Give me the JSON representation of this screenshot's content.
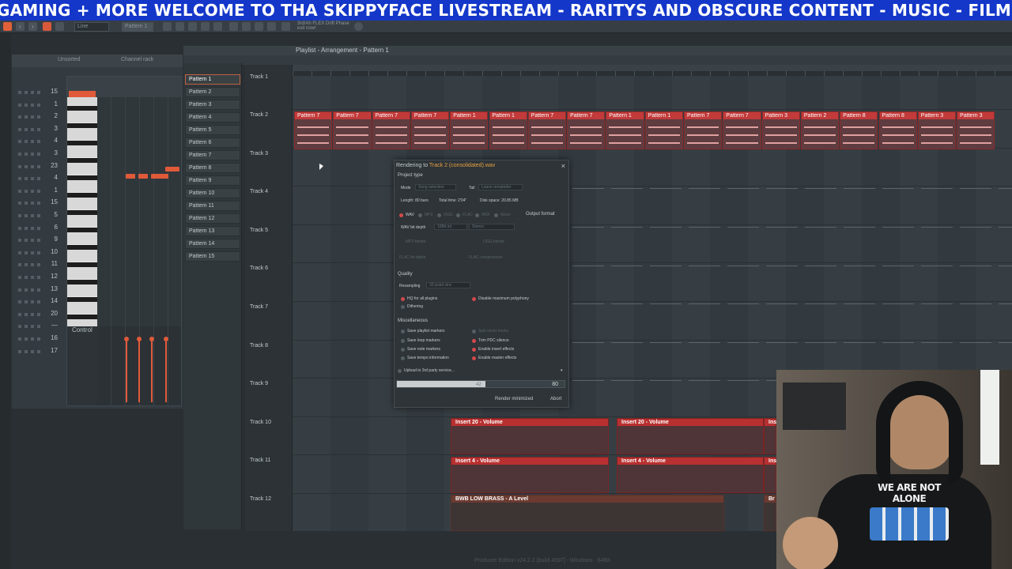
{
  "banner": {
    "text": "GAMING + MORE  WELCOME TO THA SKIPPYFACE LIVESTREAM  - RARITYS AND OBSCURE CONTENT - MUSIC - FILM - RANDOM"
  },
  "toolbar": {
    "mode_field": "Line",
    "pattern_field": "Pattern 1",
    "hint_line1": "3rd/Ah  FLEX Drift Phase",
    "hint_line2": "exit now!"
  },
  "channel_rack": {
    "title_left": "Unsorted",
    "title_right": "Channel rack",
    "numbers": [
      "15",
      "1",
      "2",
      "3",
      "4",
      "3",
      "23",
      "4",
      "1",
      "15",
      "5",
      "6",
      "9",
      "10",
      "11",
      "12",
      "13",
      "14",
      "20",
      "—",
      "16",
      "17"
    ]
  },
  "piano_roll": {
    "control_label": "Control"
  },
  "playlist": {
    "title": "Playlist - Arrangement - Pattern 1"
  },
  "patterns": [
    "Pattern 1",
    "Pattern 2",
    "Pattern 3",
    "Pattern 4",
    "Pattern 5",
    "Pattern 6",
    "Pattern 7",
    "Pattern 8",
    "Pattern 9",
    "Pattern 10",
    "Pattern 11",
    "Pattern 12",
    "Pattern 13",
    "Pattern 14",
    "Pattern 15"
  ],
  "tracks": [
    "Track 1",
    "Track 2",
    "Track 3",
    "Track 4",
    "Track 5",
    "Track 6",
    "Track 7",
    "Track 8",
    "Track 9",
    "Track 10",
    "Track 11",
    "Track 12"
  ],
  "track2_clips": [
    "Pattern 7",
    "Pattern 7",
    "Pattern 7",
    "Pattern 7",
    "Pattern 1",
    "Pattern 1",
    "Pattern 7",
    "Pattern 7",
    "Pattern 1",
    "Pattern 1",
    "Pattern 7",
    "Pattern 7",
    "Pattern 3",
    "Pattern 2",
    "Pattern 8",
    "Pattern 8",
    "Pattern 3",
    "Pattern 3"
  ],
  "automation_clips": {
    "insert20": "Insert 20 - Volume",
    "insert4": "Insert 4 - Volume",
    "brass": "BWB LOW BRASS - A Level",
    "ins": "Ins",
    "br": "Br"
  },
  "render_dialog": {
    "title_prefix": "Rendering to ",
    "title_file": "Track 2 (consolidated).wav",
    "close": "×",
    "project_type": "Project type",
    "mode_label": "Mode",
    "mode_value": "Song selection",
    "tail_label": "Tail",
    "tail_value": "Leave remainder",
    "length": "Length: 80 bars",
    "total_time": "Total time: 2'04\"",
    "disk_space": "Disk space: 20.85 MB",
    "output_format": "Output format",
    "formats": [
      "WAV",
      "MP3",
      "OGG",
      "FLAC",
      "MIDI",
      "Wave"
    ],
    "wav_bit_depth": "WAV bit depth",
    "wav_bit_value": "16Bit int",
    "stereo": "Stereo",
    "mp3_bitrate": "MP3 bitrate",
    "ogg_bitrate": "OGG bitrate",
    "flac_bit_depth": "FLAC bit depth",
    "flac_compression": "FLAC compression",
    "quality": "Quality",
    "resampling_label": "Resampling",
    "resampling_value": "32-point sinc",
    "hq_plugins": "HQ for all plugins",
    "disable_polyphony": "Disable maximum polyphony",
    "dithering": "Dithering",
    "miscellaneous": "Miscellaneous",
    "save_playlist_markers": "Save playlist markers",
    "split_mixer_tracks": "Split mixer tracks",
    "save_loop_markers": "Save loop markers",
    "trim_pdc_silence": "Trim PDC silence",
    "save_note_markers": "Save note markers",
    "enable_insert_effects": "Enable insert effects",
    "save_tempo_info": "Save tempo information",
    "enable_master_effects": "Enable master effects",
    "upload": "Upload to 3rd party service...",
    "progress_inner": "42",
    "progress_value": "80",
    "progress_fraction": 0.53,
    "render_minimized": "Render minimized",
    "abort": "Abort"
  },
  "webcam": {
    "shirt_text": "WE ARE NOT ALONE"
  },
  "footer": "Producer Edition v24.2.2 [build 4597] - Windows - 64Bit"
}
